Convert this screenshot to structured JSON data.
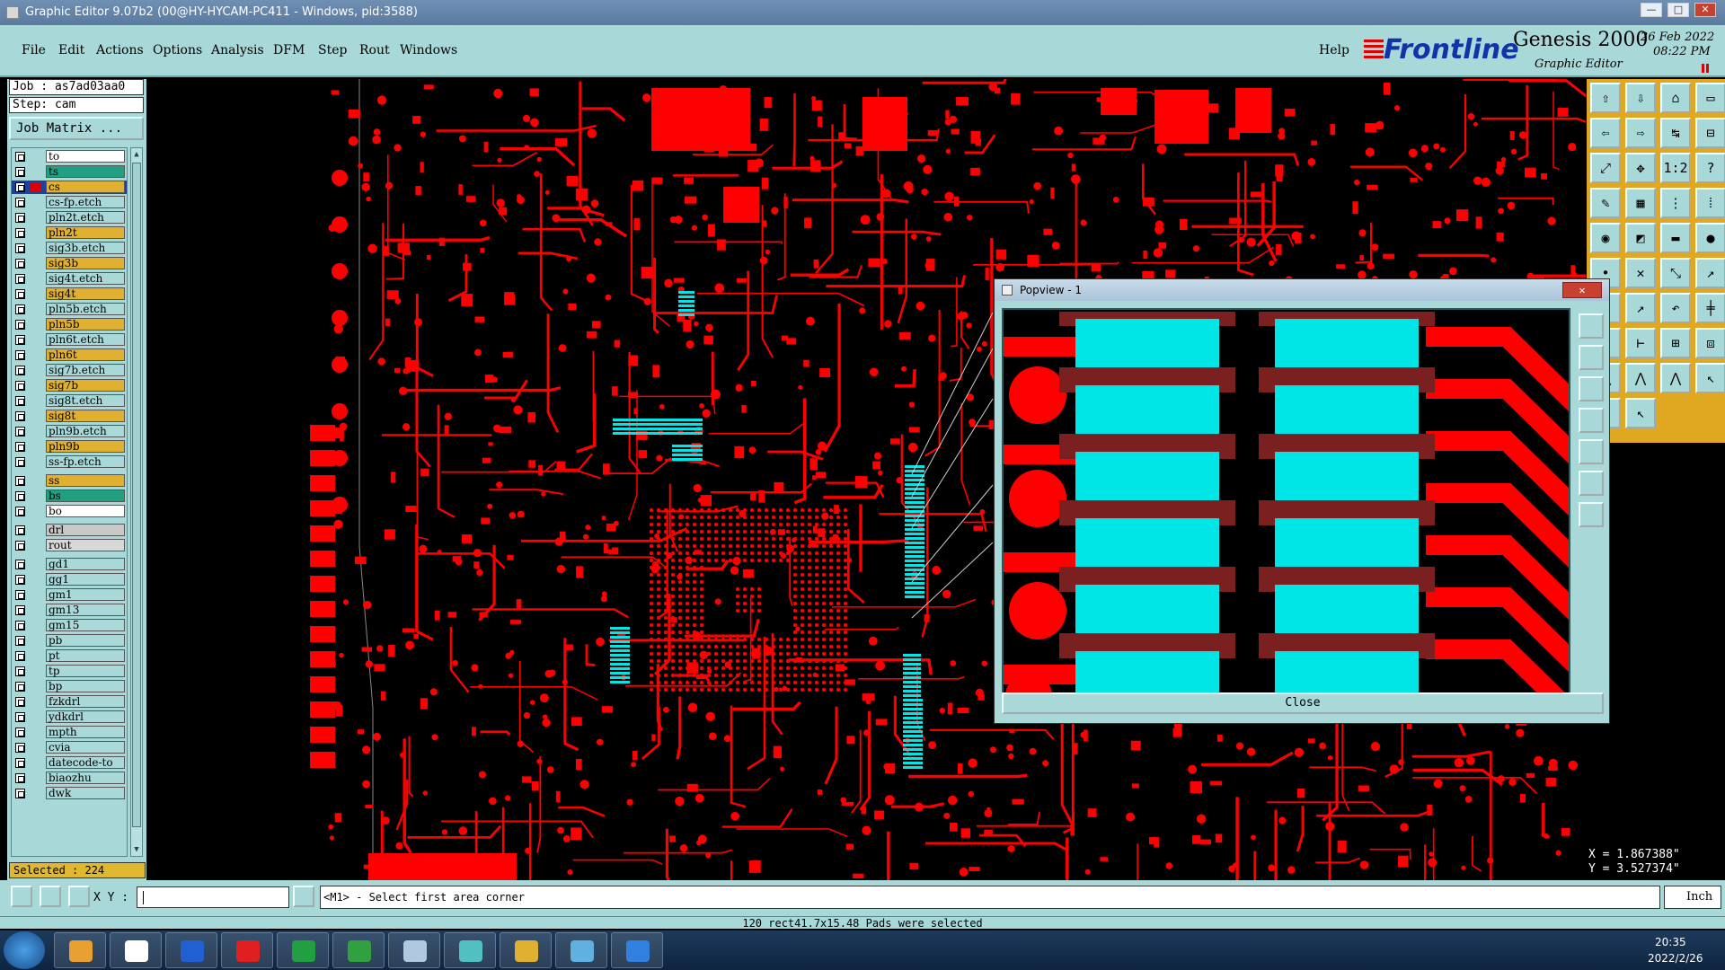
{
  "window": {
    "title": "Graphic Editor 9.07b2 (00@HY-HYCAM-PC411 - Windows, pid:3588)",
    "minimize": "—",
    "maximize": "□",
    "close": "✕"
  },
  "menu": [
    "File",
    "Edit",
    "Actions",
    "Options",
    "Analysis",
    "DFM",
    "Step",
    "Rout",
    "Windows"
  ],
  "help": "Help",
  "brand": {
    "logo": "Frontline",
    "product": "Genesis 2000",
    "subtitle": "Graphic Editor",
    "date": "26 Feb 2022",
    "time": "08:22 PM"
  },
  "job": {
    "job_label": "Job : as7ad03aa0",
    "step_label": "Step: cam",
    "matrix_button": "Job Matrix ..."
  },
  "layers": [
    {
      "name": "to",
      "color": "#ffffff"
    },
    {
      "name": "ts",
      "color": "#20a080"
    },
    {
      "name": "cs",
      "color": "#e0b030",
      "active": true
    },
    {
      "name": "cs-fp.etch",
      "color": "#a8d8d8"
    },
    {
      "name": "pln2t.etch",
      "color": "#a8d8d8"
    },
    {
      "name": "pln2t",
      "color": "#e0b030"
    },
    {
      "name": "sig3b.etch",
      "color": "#a8d8d8"
    },
    {
      "name": "sig3b",
      "color": "#e0b030"
    },
    {
      "name": "sig4t.etch",
      "color": "#a8d8d8"
    },
    {
      "name": "sig4t",
      "color": "#e0b030"
    },
    {
      "name": "pln5b.etch",
      "color": "#a8d8d8"
    },
    {
      "name": "pln5b",
      "color": "#e0b030"
    },
    {
      "name": "pln6t.etch",
      "color": "#a8d8d8"
    },
    {
      "name": "pln6t",
      "color": "#e0b030"
    },
    {
      "name": "sig7b.etch",
      "color": "#a8d8d8"
    },
    {
      "name": "sig7b",
      "color": "#e0b030"
    },
    {
      "name": "sig8t.etch",
      "color": "#a8d8d8"
    },
    {
      "name": "sig8t",
      "color": "#e0b030"
    },
    {
      "name": "pln9b.etch",
      "color": "#a8d8d8"
    },
    {
      "name": "pln9b",
      "color": "#e0b030"
    },
    {
      "name": "ss-fp.etch",
      "color": "#a8d8d8"
    },
    {
      "name": "ss",
      "color": "#e0b030"
    },
    {
      "name": "bs",
      "color": "#20a080"
    },
    {
      "name": "bo",
      "color": "#ffffff"
    },
    {
      "name": "drl",
      "color": "#c8c8c8"
    },
    {
      "name": "rout",
      "color": "#d8d8d8"
    },
    {
      "name": "gd1",
      "color": "#a8d8d8"
    },
    {
      "name": "gg1",
      "color": "#a8d8d8"
    },
    {
      "name": "gm1",
      "color": "#a8d8d8"
    },
    {
      "name": "gm13",
      "color": "#a8d8d8"
    },
    {
      "name": "gm15",
      "color": "#a8d8d8"
    },
    {
      "name": "pb",
      "color": "#a8d8d8"
    },
    {
      "name": "pt",
      "color": "#a8d8d8"
    },
    {
      "name": "tp",
      "color": "#a8d8d8"
    },
    {
      "name": "bp",
      "color": "#a8d8d8"
    },
    {
      "name": "fzkdrl",
      "color": "#a8d8d8"
    },
    {
      "name": "ydkdrl",
      "color": "#a8d8d8"
    },
    {
      "name": "mpth",
      "color": "#a8d8d8"
    },
    {
      "name": "cvia",
      "color": "#a8d8d8"
    },
    {
      "name": "datecode-to",
      "color": "#a8d8d8"
    },
    {
      "name": "biaozhu",
      "color": "#a8d8d8"
    },
    {
      "name": "dwk",
      "color": "#a8d8d8"
    }
  ],
  "selected": "Selected : 224",
  "coords": {
    "x": "X = 1.867388\"",
    "y": "Y = 3.527374\""
  },
  "command": {
    "xy_label": "X Y :",
    "xy_value": "",
    "prompt": "<M1> - Select first area corner",
    "unit": "Inch"
  },
  "status": "120 rect41.7x15.48 Pads were selected",
  "popview": {
    "title": "Popview - 1",
    "close_button": "Close",
    "close_x": "✕"
  },
  "taskbar": {
    "time": "20:35",
    "date": "2022/2/26"
  },
  "colors": {
    "copper": "#ff0000",
    "selected": "#00e5e5",
    "panel": "#a8d8d8",
    "toolbar": "#e0a820"
  }
}
